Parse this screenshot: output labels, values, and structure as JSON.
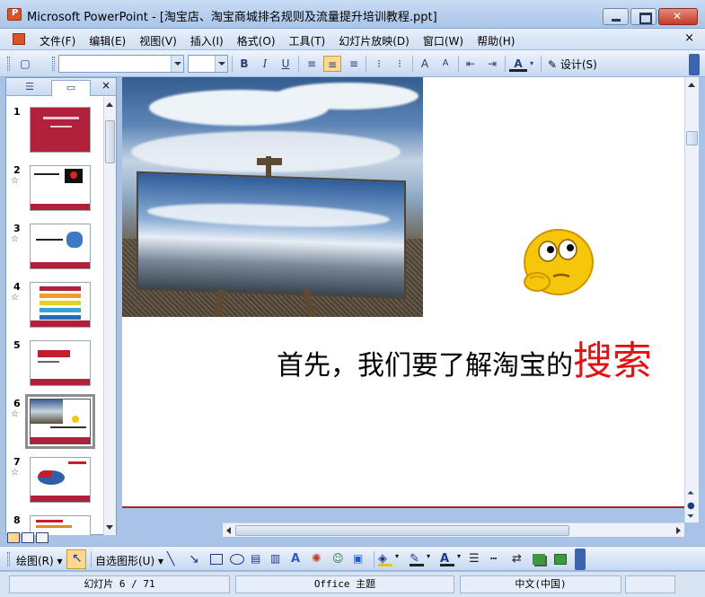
{
  "window": {
    "title": "Microsoft PowerPoint - [淘宝店、淘宝商城排名规则及流量提升培训教程.ppt]"
  },
  "menubar": {
    "items": [
      "文件(F)",
      "编辑(E)",
      "视图(V)",
      "插入(I)",
      "格式(O)",
      "工具(T)",
      "幻灯片放映(D)",
      "窗口(W)",
      "帮助(H)"
    ],
    "close_glyph": "×"
  },
  "toolbar": {
    "font_name": "",
    "font_size": "",
    "design_label": "设计(S)"
  },
  "left_pane": {
    "close_glyph": "×",
    "slides": [
      {
        "number": "1",
        "has_star": false
      },
      {
        "number": "2",
        "has_star": true
      },
      {
        "number": "3",
        "has_star": true
      },
      {
        "number": "4",
        "has_star": true
      },
      {
        "number": "5",
        "has_star": false
      },
      {
        "number": "6",
        "has_star": true,
        "selected": true
      },
      {
        "number": "7",
        "has_star": true
      },
      {
        "number": "8",
        "has_star": false
      }
    ]
  },
  "slide": {
    "text_normal": "首先，我们要了解淘宝的",
    "text_highlight": "搜索",
    "highlight_color": "#e51010",
    "footer_color": "#a81f36"
  },
  "drawbar": {
    "draw_label": "绘图(R)",
    "autoshape_label": "自选图形(U)"
  },
  "status": {
    "slide_position": "幻灯片 6 / 71",
    "theme": "Office 主题",
    "language": "中文(中国)"
  }
}
